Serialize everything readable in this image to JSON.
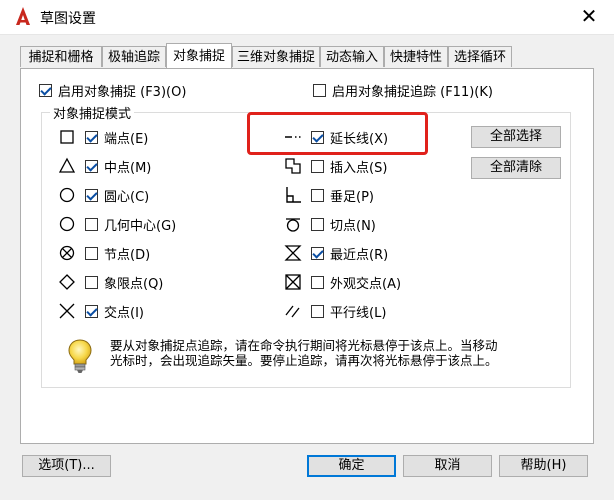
{
  "window": {
    "title": "草图设置",
    "close_glyph": "✕"
  },
  "tabs": [
    {
      "label": "捕捉和栅格",
      "active": false
    },
    {
      "label": "极轴追踪",
      "active": false
    },
    {
      "label": "对象捕捉",
      "active": true
    },
    {
      "label": "三维对象捕捉",
      "active": false
    },
    {
      "label": "动态输入",
      "active": false
    },
    {
      "label": "快捷特性",
      "active": false
    },
    {
      "label": "选择循环",
      "active": false
    }
  ],
  "top_options": {
    "enable_osnap": {
      "label": "启用对象捕捉 (F3)(O)",
      "checked": true
    },
    "enable_tracking": {
      "label": "启用对象捕捉追踪 (F11)(K)",
      "checked": false
    }
  },
  "group": {
    "label": "对象捕捉模式"
  },
  "modes_left": [
    {
      "label": "端点(E)",
      "checked": true,
      "icon": "square-icon"
    },
    {
      "label": "中点(M)",
      "checked": true,
      "icon": "triangle-icon"
    },
    {
      "label": "圆心(C)",
      "checked": true,
      "icon": "circle-icon"
    },
    {
      "label": "几何中心(G)",
      "checked": false,
      "icon": "circle-icon"
    },
    {
      "label": "节点(D)",
      "checked": false,
      "icon": "node-icon"
    },
    {
      "label": "象限点(Q)",
      "checked": false,
      "icon": "diamond-icon"
    },
    {
      "label": "交点(I)",
      "checked": true,
      "icon": "x-icon"
    }
  ],
  "modes_right": [
    {
      "label": "延长线(X)",
      "checked": true,
      "icon": "extension-icon"
    },
    {
      "label": "插入点(S)",
      "checked": false,
      "icon": "insertion-icon"
    },
    {
      "label": "垂足(P)",
      "checked": false,
      "icon": "perpendicular-icon"
    },
    {
      "label": "切点(N)",
      "checked": false,
      "icon": "tangent-icon"
    },
    {
      "label": "最近点(R)",
      "checked": true,
      "icon": "hourglass-icon"
    },
    {
      "label": "外观交点(A)",
      "checked": false,
      "icon": "boxed-x-icon"
    },
    {
      "label": "平行线(L)",
      "checked": false,
      "icon": "parallel-icon"
    }
  ],
  "side_buttons": {
    "select_all": "全部选择",
    "clear_all": "全部清除"
  },
  "tip": {
    "line1": "要从对象捕捉点追踪，请在命令执行期间将光标悬停于该点上。当移动",
    "line2": "光标时，会出现追踪矢量。要停止追踪，请再次将光标悬停于该点上。"
  },
  "footer": {
    "options": "选项(T)...",
    "ok": "确定",
    "cancel": "取消",
    "help": "帮助(H)"
  },
  "colors": {
    "highlight": "#e0211b",
    "logo": "#c8281e",
    "check": "#0a4ea3"
  }
}
